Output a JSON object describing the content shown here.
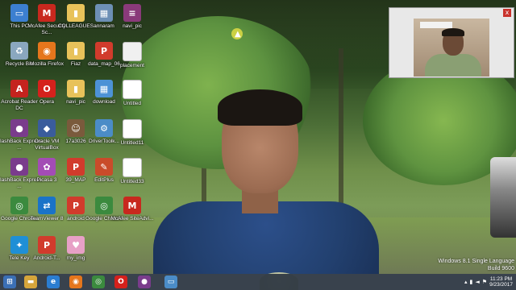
{
  "desktop": {
    "icons": [
      {
        "label": "This PC",
        "icon": "computer-icon",
        "color": "#3c7fd0",
        "glyph": "▭"
      },
      {
        "label": "McAfee Security Sc...",
        "icon": "mcafee-icon",
        "color": "#c8281e",
        "glyph": "M"
      },
      {
        "label": "COLLEAGUES",
        "icon": "folder-icon",
        "color": "#e8c25a",
        "glyph": "▮"
      },
      {
        "label": "annaram",
        "icon": "image-file-icon",
        "color": "#6d8fb5",
        "glyph": "▦"
      },
      {
        "label": "navi_pic",
        "icon": "winrar-icon",
        "color": "#8a3a7a",
        "glyph": "≡"
      },
      {
        "label": "Recycle Bin",
        "icon": "recycle-bin-icon",
        "color": "#8aa7bf",
        "glyph": "♻"
      },
      {
        "label": "Mozilla Firefox",
        "icon": "firefox-icon",
        "color": "#e5761c",
        "glyph": "◉"
      },
      {
        "label": "Fiaz",
        "icon": "folder-icon",
        "color": "#e8c25a",
        "glyph": "▮"
      },
      {
        "label": "data_map_06",
        "icon": "pdf-icon",
        "color": "#d13b2c",
        "glyph": "P"
      },
      {
        "label": "placement",
        "icon": "document-icon",
        "color": "#f0f0f0",
        "glyph": ""
      },
      {
        "label": "Acrobat Reader DC",
        "icon": "acrobat-icon",
        "color": "#c5231e",
        "glyph": "A"
      },
      {
        "label": "Opera",
        "icon": "opera-icon",
        "color": "#d5211c",
        "glyph": "O"
      },
      {
        "label": "navi_pic",
        "icon": "folder-icon",
        "color": "#e8c25a",
        "glyph": "▮"
      },
      {
        "label": "download",
        "icon": "image-file-icon",
        "color": "#4d92d6",
        "glyph": "▦"
      },
      {
        "label": "Untitled",
        "icon": "blank-file-icon",
        "color": "#ffffff",
        "glyph": ""
      },
      {
        "label": "FlashBack Express ...",
        "icon": "flashback-icon",
        "color": "#7a3c8c",
        "glyph": "●"
      },
      {
        "label": "Oracle VM VirtualBox",
        "icon": "virtualbox-icon",
        "color": "#3a5c9c",
        "glyph": "◆"
      },
      {
        "label": "17a3026",
        "icon": "photo-icon",
        "color": "#7a5a3c",
        "glyph": "☺"
      },
      {
        "label": "DriverToolk...",
        "icon": "drivertoolkit-icon",
        "color": "#4b8cc7",
        "glyph": "⚙"
      },
      {
        "label": "Untitled11",
        "icon": "blank-file-icon",
        "color": "#ffffff",
        "glyph": ""
      },
      {
        "label": "FlashBack Express ...",
        "icon": "flashback-icon",
        "color": "#7a3c8c",
        "glyph": "●"
      },
      {
        "label": "Picasa 3",
        "icon": "picasa-icon",
        "color": "#a34cb5",
        "glyph": "✿"
      },
      {
        "label": "39_MAP",
        "icon": "pdf-icon",
        "color": "#d13b2c",
        "glyph": "P"
      },
      {
        "label": "EditPlus",
        "icon": "editplus-icon",
        "color": "#c94b2a",
        "glyph": "✎"
      },
      {
        "label": "Untitled33",
        "icon": "blank-file-icon",
        "color": "#ffffff",
        "glyph": ""
      },
      {
        "label": "Google Chrome",
        "icon": "chrome-icon",
        "color": "#3b8a3e",
        "glyph": "◎"
      },
      {
        "label": "TeamViewer 8",
        "icon": "teamviewer-icon",
        "color": "#1a73c8",
        "glyph": "⇄"
      },
      {
        "label": "android",
        "icon": "pdf-icon",
        "color": "#d13b2c",
        "glyph": "P"
      },
      {
        "label": "Google Chrome",
        "icon": "chrome-icon",
        "color": "#3b8a3e",
        "glyph": "◎"
      },
      {
        "label": "McAfee SiteAdvi...",
        "icon": "mcafee-icon",
        "color": "#c8281e",
        "glyph": "M"
      },
      {
        "label": "Tele Key",
        "icon": "telekey-icon",
        "color": "#1f8fd6",
        "glyph": "✦"
      },
      {
        "label": "Android-T...",
        "icon": "pdf-icon",
        "color": "#d13b2c",
        "glyph": "P"
      },
      {
        "label": "my_img",
        "icon": "image-file-icon",
        "color": "#e7a0c6",
        "glyph": "♥"
      }
    ]
  },
  "webcam": {
    "close_label": "x"
  },
  "watermark": {
    "line1": "Windows 8.1 Single Language",
    "line2": "Build 9600"
  },
  "taskbar": {
    "buttons": [
      {
        "icon": "start-icon",
        "color": "#3b6fb5",
        "glyph": "⊞"
      },
      {
        "icon": "file-explorer-icon",
        "color": "#d6a53b",
        "glyph": "▬"
      },
      {
        "icon": "internet-explorer-icon",
        "color": "#2b7dd1",
        "glyph": "e"
      },
      {
        "icon": "firefox-icon",
        "color": "#e5761c",
        "glyph": "◉"
      },
      {
        "icon": "chrome-icon",
        "color": "#3b8a3e",
        "glyph": "◎"
      },
      {
        "icon": "opera-icon",
        "color": "#d5211c",
        "glyph": "O"
      },
      {
        "icon": "flashback-icon",
        "color": "#7a3c8c",
        "glyph": "●"
      },
      {
        "icon": "desktop-window-icon",
        "color": "#4b8cc7",
        "glyph": "▭"
      }
    ],
    "time": "11:23 PM",
    "date": "9/23/2017"
  }
}
